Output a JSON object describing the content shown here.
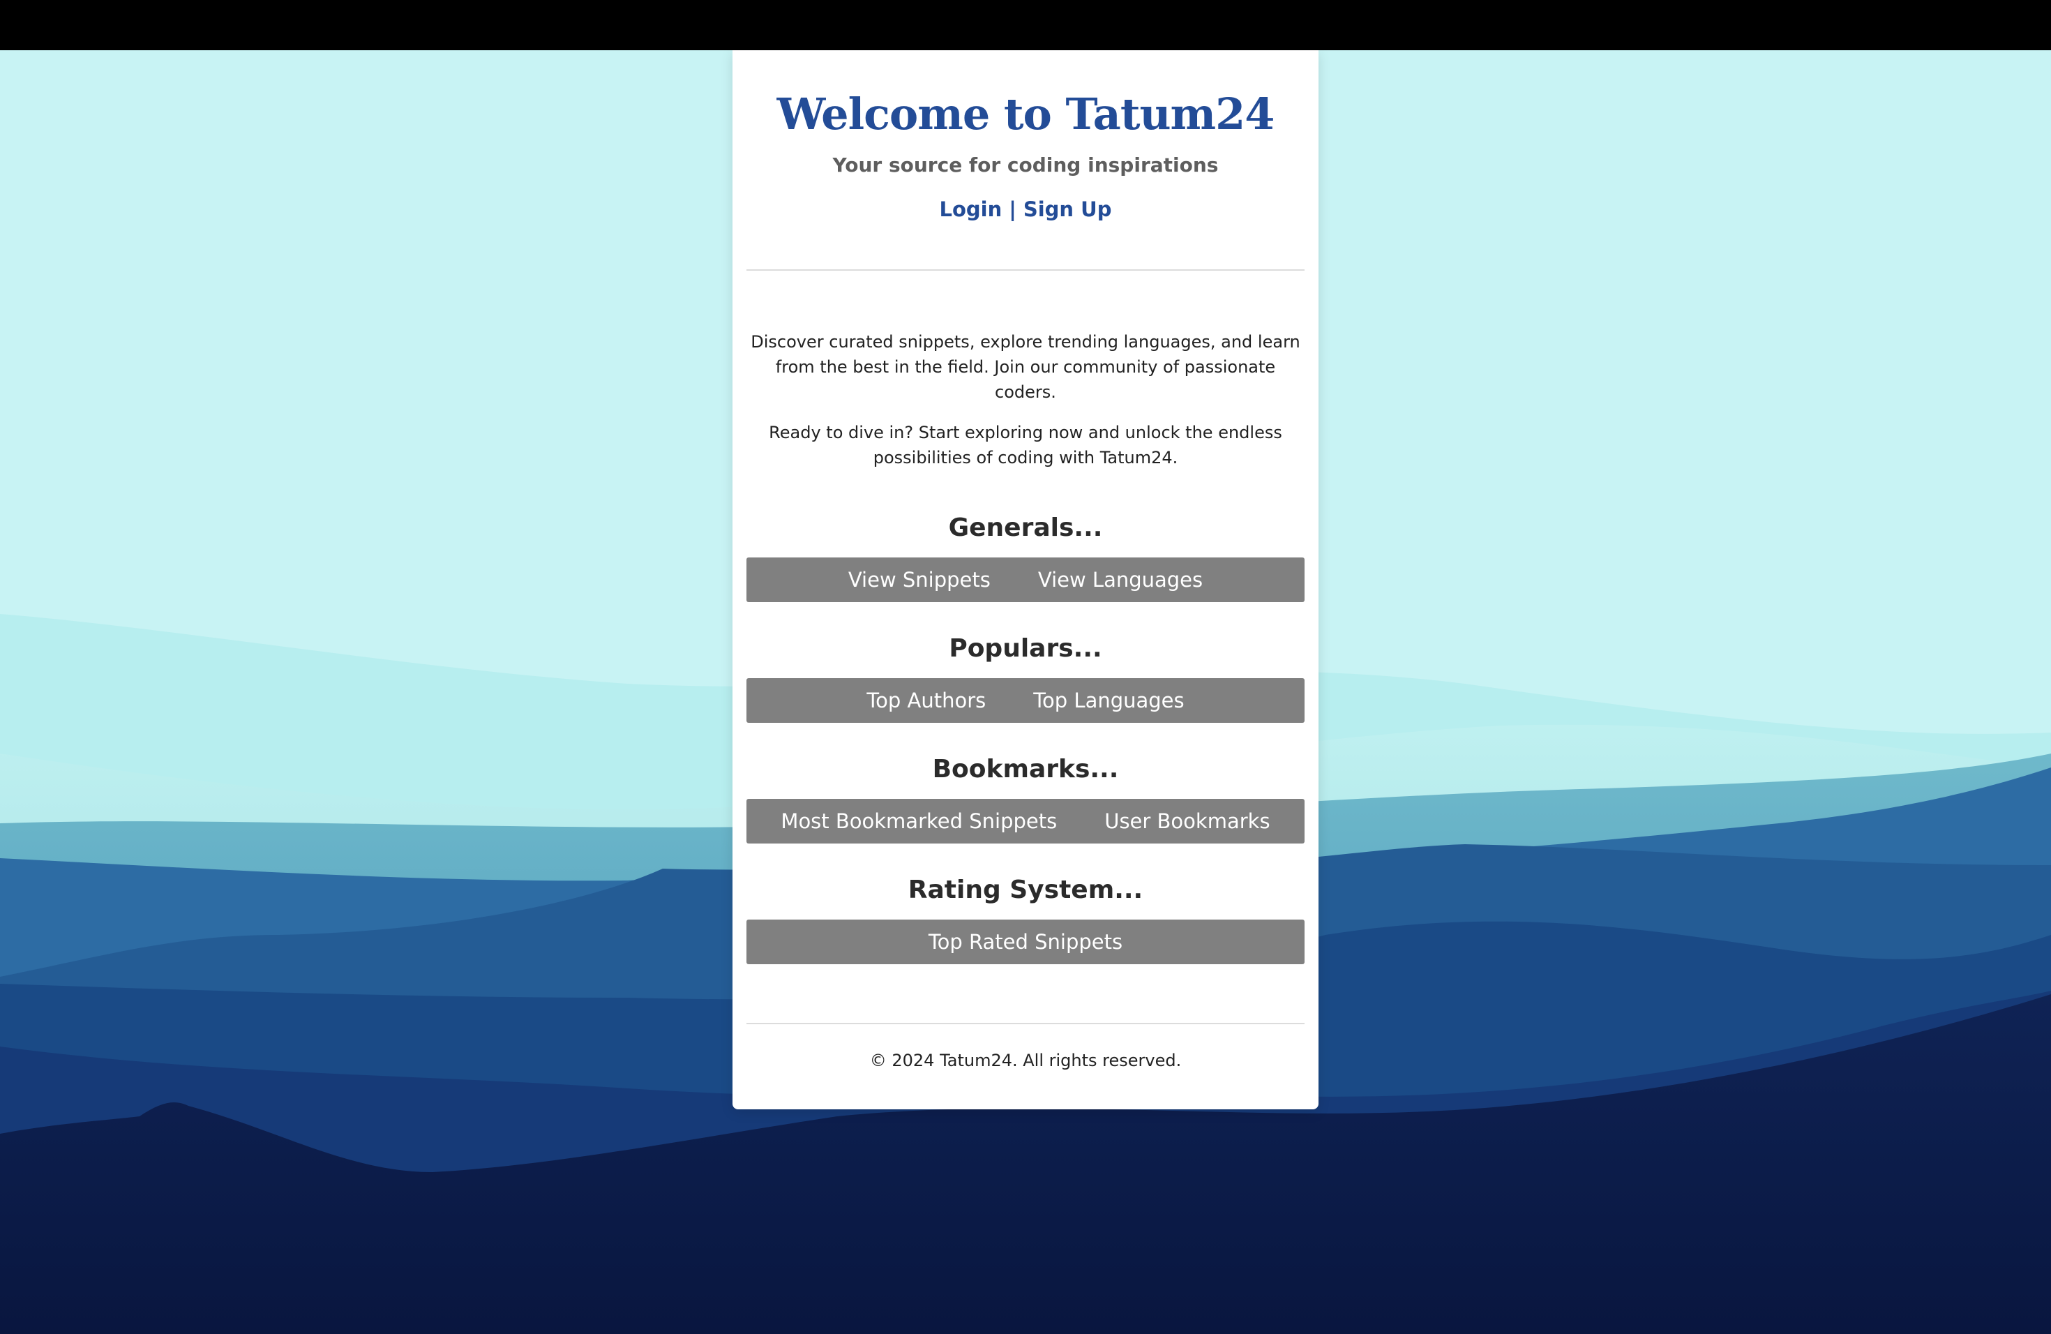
{
  "header": {
    "title": "Welcome to Tatum24",
    "tagline": "Your source for coding inspirations",
    "login_label": "Login",
    "separator": "|",
    "signup_label": "Sign Up"
  },
  "intro": {
    "paragraph1": "Discover curated snippets, explore trending languages, and learn from the best in the field. Join our community of passionate coders.",
    "paragraph2": "Ready to dive in? Start exploring now and unlock the endless possibilities of coding with Tatum24."
  },
  "sections": [
    {
      "title": "Generals...",
      "buttons": [
        "View Snippets",
        "View Languages"
      ]
    },
    {
      "title": "Populars...",
      "buttons": [
        "Top Authors",
        "Top Languages"
      ]
    },
    {
      "title": "Bookmarks...",
      "buttons": [
        "Most Bookmarked Snippets",
        "User Bookmarks"
      ]
    },
    {
      "title": "Rating System...",
      "buttons": [
        "Top Rated Snippets"
      ]
    }
  ],
  "footer": {
    "text": "© 2024 Tatum24. All rights reserved."
  },
  "colors": {
    "accent": "#234c97",
    "button_bg": "#808080",
    "sky": "#c8f3f4",
    "top_bar": "#000000"
  }
}
